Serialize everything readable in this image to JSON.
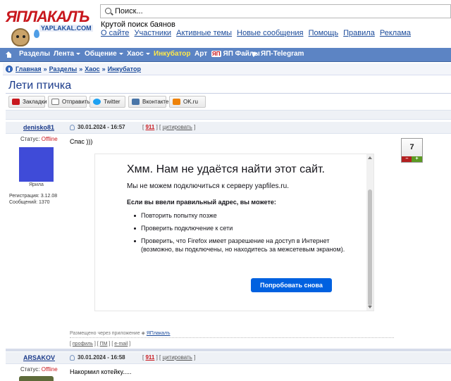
{
  "header": {
    "logo_text": "ЯПЛАКАЛЪ",
    "logo_sub": "YAPLAKAL.COM",
    "search_placeholder": "Поиск...",
    "tagline": "Крутой поиск баянов",
    "top_links": [
      "О сайте",
      "Участники",
      "Активные темы",
      "Новые сообщения",
      "Помощь",
      "Правила",
      "Реклама"
    ]
  },
  "navbar": {
    "items": [
      {
        "label": "Разделы",
        "dropdown": false
      },
      {
        "label": "Лента",
        "dropdown": true
      },
      {
        "label": "Общение",
        "dropdown": true
      },
      {
        "label": "Хаос",
        "dropdown": true
      },
      {
        "label": "Инкубатор",
        "dropdown": false,
        "highlight": true
      },
      {
        "label": "Арт",
        "dropdown": false
      },
      {
        "label": "ЯП Файлы",
        "dropdown": false,
        "badge": "ЯП"
      },
      {
        "label": "ЯП-Telegram",
        "dropdown": false,
        "icon": "telegram-icon"
      }
    ]
  },
  "breadcrumb": {
    "items": [
      "Главная",
      "Разделы",
      "Хаос",
      "Инкубатор"
    ],
    "separator": "»"
  },
  "topic": {
    "title": "Лети птичка"
  },
  "share": [
    {
      "label": "Закладки",
      "icon": "yap-bookmark-icon",
      "color": "#c8181e"
    },
    {
      "label": "Отправить",
      "icon": "mail-icon",
      "color": "#777777"
    },
    {
      "label": "Twitter",
      "icon": "twitter-icon",
      "color": "#1da1f2"
    },
    {
      "label": "Вконтакте",
      "icon": "vk-icon",
      "color": "#4a76a8"
    },
    {
      "label": "OK.ru",
      "icon": "ok-icon",
      "color": "#ee8208"
    }
  ],
  "post1": {
    "author": "denisko81",
    "date": "30.01.2024 - 16:57",
    "number": "911",
    "quote_label": "цитировать",
    "status_label": "Статус:",
    "status_value": "Offline",
    "avatar_caption": "Ярила",
    "reg_label": "Регистрация: 3.12.08",
    "msgs_label": "Сообщений: 1370",
    "text": "Спас )))",
    "rating": "7",
    "rating_minus": "–",
    "rating_plus": "+",
    "via_text": "Размещено через приложение",
    "via_app": "ЯПлакалъ",
    "footer_links": [
      "профиль",
      "ПМ",
      "e-mail"
    ]
  },
  "embed_error": {
    "title": "Хмм. Нам не удаётся найти этот сайт.",
    "subtitle": "Мы не можем подключиться к серверу yapfiles.ru.",
    "lead": "Если вы ввели правильный адрес, вы можете:",
    "items": [
      "Повторить попытку позже",
      "Проверить подключение к сети",
      "Проверить, что Firefox имеет разрешение на доступ в Интернет (возможно, вы подключены, но находитесь за межсетевым экраном)."
    ],
    "button": "Попробовать снова"
  },
  "post2": {
    "author": "ARSAKOV",
    "date": "30.01.2024 - 16:58",
    "number": "911",
    "quote_label": "цитировать",
    "status_label": "Статус:",
    "status_value": "Offline",
    "text": "Накормил котейку....."
  }
}
